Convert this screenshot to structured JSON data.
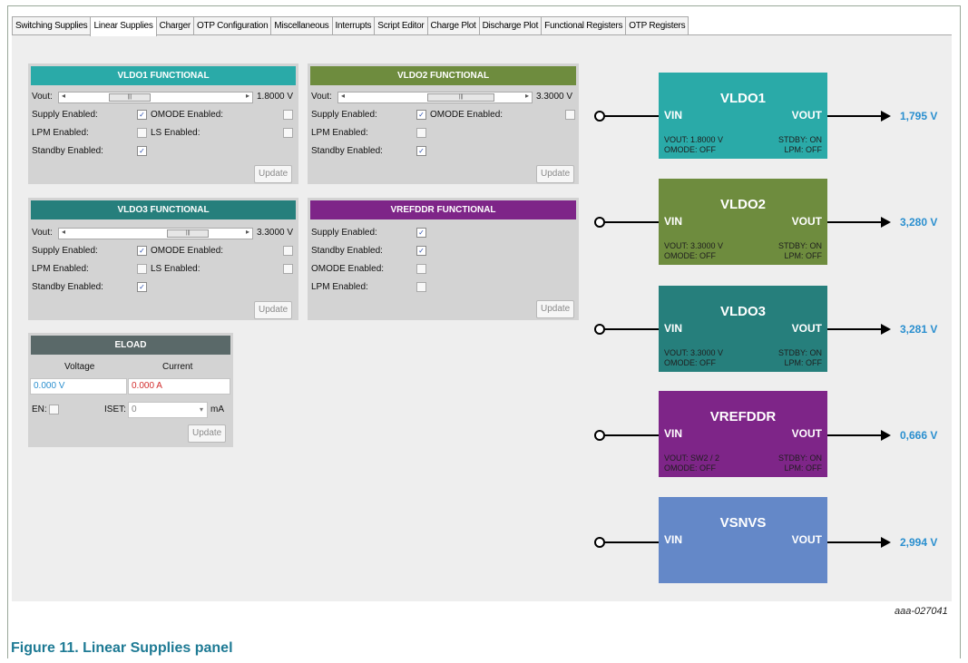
{
  "tabs": [
    "Switching Supplies",
    "Linear Supplies",
    "Charger",
    "OTP Configuration",
    "Miscellaneous",
    "Interrupts",
    "Script Editor",
    "Charge Plot",
    "Discharge Plot",
    "Functional Registers",
    "OTP Registers"
  ],
  "active_tab": "Linear Supplies",
  "colors": {
    "vldo1": "#2aaaa8",
    "vldo2": "#6e8c3e",
    "vldo3": "#267f7c",
    "vrefddr": "#7e2588",
    "vsnvs": "#6488c8",
    "eload": "#5a6969",
    "value_blue": "#2a8fcf",
    "value_red": "#d22d2d"
  },
  "panels": {
    "vldo1": {
      "title": "VLDO1 FUNCTIONAL",
      "vout_label": "Vout:",
      "vout_value": "1.8000 V",
      "slider_position": 0.3,
      "supply_enabled_label": "Supply Enabled:",
      "supply_enabled": true,
      "omode_label": "OMODE Enabled:",
      "omode": false,
      "lpm_label": "LPM Enabled:",
      "lpm": false,
      "ls_label": "LS Enabled:",
      "ls": false,
      "standby_label": "Standby Enabled:",
      "standby": true,
      "update_label": "Update"
    },
    "vldo2": {
      "title": "VLDO2 FUNCTIONAL",
      "vout_label": "Vout:",
      "vout_value": "3.3000 V",
      "slider_position": 0.75,
      "supply_enabled_label": "Supply Enabled:",
      "supply_enabled": true,
      "omode_label": "OMODE Enabled:",
      "omode": false,
      "lpm_label": "LPM Enabled:",
      "lpm": false,
      "standby_label": "Standby Enabled:",
      "standby": true,
      "update_label": "Update"
    },
    "vldo3": {
      "title": "VLDO3 FUNCTIONAL",
      "vout_label": "Vout:",
      "vout_value": "3.3000 V",
      "slider_position": 0.75,
      "supply_enabled_label": "Supply Enabled:",
      "supply_enabled": true,
      "omode_label": "OMODE Enabled:",
      "omode": false,
      "lpm_label": "LPM Enabled:",
      "lpm": false,
      "ls_label": "LS Enabled:",
      "ls": false,
      "standby_label": "Standby Enabled:",
      "standby": true,
      "update_label": "Update"
    },
    "vrefddr": {
      "title": "VREFDDR FUNCTIONAL",
      "supply_enabled_label": "Supply Enabled:",
      "supply_enabled": true,
      "standby_label": "Standby Enabled:",
      "standby": true,
      "omode_label": "OMODE Enabled:",
      "omode": false,
      "lpm_label": "LPM Enabled:",
      "lpm": false,
      "update_label": "Update"
    },
    "eload": {
      "title": "ELOAD",
      "voltage_label": "Voltage",
      "current_label": "Current",
      "voltage_value": "0.000 V",
      "current_value": "0.000 A",
      "en_label": "EN:",
      "en": false,
      "iset_label": "ISET:",
      "iset_value": "0",
      "iset_unit": "mA",
      "update_label": "Update"
    }
  },
  "diagram": {
    "vin_label": "VIN",
    "vout_label": "VOUT",
    "blocks": [
      {
        "name": "VLDO1",
        "output": "1,795 V",
        "status_left_1": "VOUT: 1.8000 V",
        "status_right_1": "STDBY: ON",
        "status_left_2": "OMODE: OFF",
        "status_right_2": "LPM: OFF"
      },
      {
        "name": "VLDO2",
        "output": "3,280 V",
        "status_left_1": "VOUT: 3.3000 V",
        "status_right_1": "STDBY: ON",
        "status_left_2": "OMODE: OFF",
        "status_right_2": "LPM: OFF"
      },
      {
        "name": "VLDO3",
        "output": "3,281 V",
        "status_left_1": "VOUT: 3.3000 V",
        "status_right_1": "STDBY: ON",
        "status_left_2": "OMODE: OFF",
        "status_right_2": "LPM: OFF"
      },
      {
        "name": "VREFDDR",
        "output": "0,666 V",
        "status_left_1": "VOUT: SW2 / 2",
        "status_right_1": "STDBY: ON",
        "status_left_2": "OMODE: OFF",
        "status_right_2": "LPM: OFF"
      },
      {
        "name": "VSNVS",
        "output": "2,994 V"
      }
    ]
  },
  "figure_id": "aaa-027041",
  "caption": "Figure 11.  Linear Supplies panel"
}
